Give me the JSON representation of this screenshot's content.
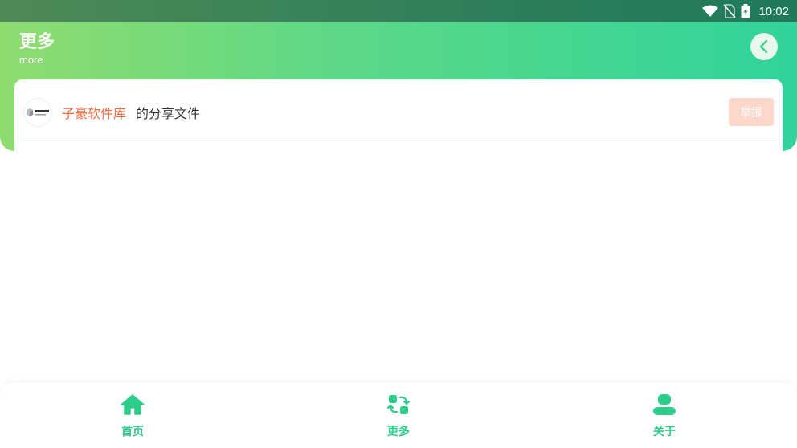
{
  "status_bar": {
    "time": "10:02"
  },
  "header": {
    "title": "更多",
    "subtitle": "more"
  },
  "share": {
    "author": "子豪软件库",
    "suffix": "的分享文件",
    "report_label": "举报"
  },
  "nav": {
    "items": [
      {
        "label": "首页",
        "icon": "home-icon"
      },
      {
        "label": "更多",
        "icon": "swap-icon"
      },
      {
        "label": "关于",
        "icon": "user-icon"
      }
    ]
  },
  "colors": {
    "accent": "#2ecc8a",
    "author": "#f06a3f",
    "report_bg": "#fdd6cc"
  }
}
